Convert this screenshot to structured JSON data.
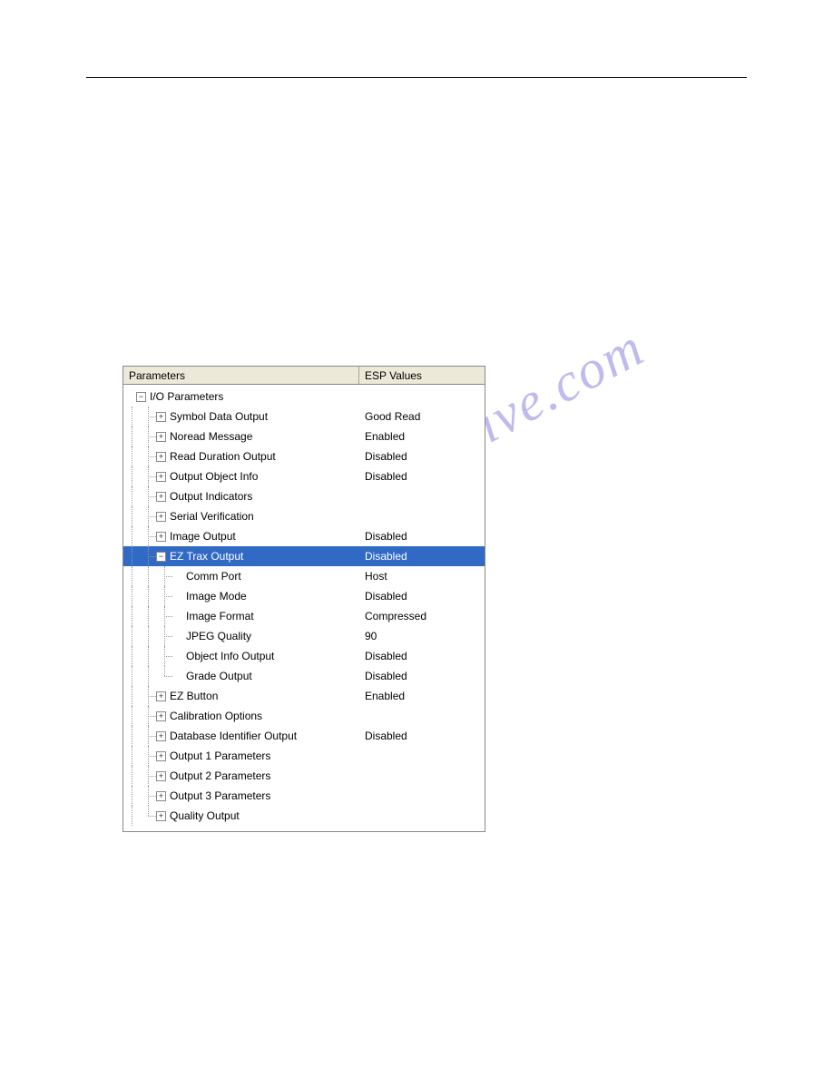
{
  "watermark": "manualchive.com",
  "header": {
    "parameters": "Parameters",
    "values": "ESP Values"
  },
  "root": {
    "label": "I/O Parameters"
  },
  "items": [
    {
      "label": "Symbol Data Output",
      "value": "Good Read",
      "expand": "+"
    },
    {
      "label": "Noread Message",
      "value": "Enabled",
      "expand": "+"
    },
    {
      "label": "Read Duration Output",
      "value": "Disabled",
      "expand": "+"
    },
    {
      "label": "Output Object Info",
      "value": "Disabled",
      "expand": "+"
    },
    {
      "label": "Output Indicators",
      "value": "",
      "expand": "+"
    },
    {
      "label": "Serial Verification",
      "value": "",
      "expand": "+"
    },
    {
      "label": "Image Output",
      "value": "Disabled",
      "expand": "+"
    },
    {
      "label": "EZ Trax Output",
      "value": "Disabled",
      "expand": "-",
      "selected": true
    },
    {
      "label": "EZ Button",
      "value": "Enabled",
      "expand": "+"
    },
    {
      "label": "Calibration Options",
      "value": "",
      "expand": "+"
    },
    {
      "label": "Database Identifier Output",
      "value": "Disabled",
      "expand": "+"
    },
    {
      "label": "Output 1 Parameters",
      "value": "",
      "expand": "+"
    },
    {
      "label": "Output 2 Parameters",
      "value": "",
      "expand": "+"
    },
    {
      "label": "Output 3 Parameters",
      "value": "",
      "expand": "+"
    },
    {
      "label": "Quality Output",
      "value": "",
      "expand": "+"
    }
  ],
  "ezTraxChildren": [
    {
      "label": "Comm Port",
      "value": "Host"
    },
    {
      "label": "Image Mode",
      "value": "Disabled"
    },
    {
      "label": "Image Format",
      "value": "Compressed"
    },
    {
      "label": "JPEG Quality",
      "value": "90"
    },
    {
      "label": "Object Info Output",
      "value": "Disabled"
    },
    {
      "label": "Grade Output",
      "value": "Disabled"
    }
  ],
  "glyphs": {
    "plus": "+",
    "minus": "−"
  }
}
